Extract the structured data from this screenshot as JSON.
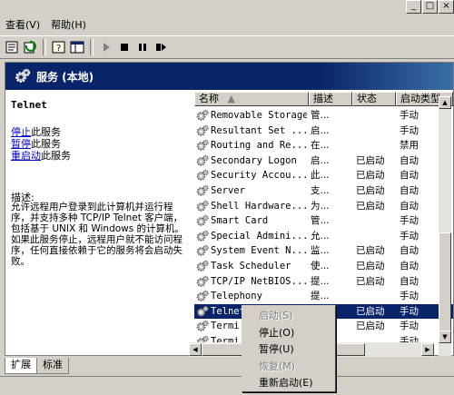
{
  "menu": {
    "items": [
      {
        "label": "查看(V)"
      },
      {
        "label": "帮助(H)"
      }
    ]
  },
  "window_controls": {
    "minimize": "_",
    "maximize": "□",
    "close": "×"
  },
  "header": {
    "title": "服务 (本地)"
  },
  "details": {
    "service_name": "Telnet",
    "actions": [
      {
        "link": "停止",
        "suffix": "此服务"
      },
      {
        "link": "暂停",
        "suffix": "此服务"
      },
      {
        "link": "重启动",
        "suffix": "此服务"
      }
    ],
    "description_label": "描述:",
    "description_text": "允许远程用户登录到此计算机并运行程序，并支持多种 TCP/IP Telnet 客户端，包括基于 UNIX 和 Windows 的计算机。如果此服务停止，远程用户就不能访问程序，任何直接依赖于它的服务将会启动失败。"
  },
  "list": {
    "columns": {
      "name": "名称",
      "description": "描述",
      "status": "状态",
      "startup": "启动类型"
    },
    "rows": [
      {
        "name": "Removable Storage",
        "description": "管...",
        "status": "",
        "startup": "手动"
      },
      {
        "name": "Resultant Set ...",
        "description": "启...",
        "status": "",
        "startup": "手动"
      },
      {
        "name": "Routing and Re...",
        "description": "在...",
        "status": "",
        "startup": "禁用"
      },
      {
        "name": "Secondary Logon",
        "description": "启...",
        "status": "已启动",
        "startup": "自动"
      },
      {
        "name": "Security Accou...",
        "description": "此...",
        "status": "已启动",
        "startup": "自动"
      },
      {
        "name": "Server",
        "description": "支...",
        "status": "已启动",
        "startup": "自动"
      },
      {
        "name": "Shell Hardware...",
        "description": "为...",
        "status": "已启动",
        "startup": "自动"
      },
      {
        "name": "Smart Card",
        "description": "管...",
        "status": "",
        "startup": "手动"
      },
      {
        "name": "Special Admini...",
        "description": "允...",
        "status": "",
        "startup": "手动"
      },
      {
        "name": "System Event N...",
        "description": "监...",
        "status": "已启动",
        "startup": "自动"
      },
      {
        "name": "Task Scheduler",
        "description": "使...",
        "status": "已启动",
        "startup": "自动"
      },
      {
        "name": "TCP/IP NetBIOS...",
        "description": "提...",
        "status": "已启动",
        "startup": "自动"
      },
      {
        "name": "Telephony",
        "description": "提...",
        "status": "",
        "startup": "手动"
      },
      {
        "name": "Telnet",
        "description": "",
        "status": "已启动",
        "startup": "手动"
      },
      {
        "name": "Termi",
        "description": "",
        "status": "已启动",
        "startup": "手动"
      },
      {
        "name": "Termi",
        "description": "",
        "status": "",
        "startup": "手动"
      }
    ],
    "selected_index": 13
  },
  "context_menu": {
    "items": [
      {
        "label": "启动(S)",
        "disabled": true
      },
      {
        "label": "停止(O)",
        "disabled": false
      },
      {
        "label": "暂停(U)",
        "disabled": false
      },
      {
        "label": "恢复(M)",
        "disabled": true
      },
      {
        "label": "重新启动(E)",
        "disabled": false
      }
    ]
  },
  "tabs": [
    {
      "label": "扩展",
      "active": true
    },
    {
      "label": "标准",
      "active": false
    }
  ],
  "colors": {
    "header_band": "#0a246a",
    "selection": "#0a246a",
    "link": "#0000cc",
    "chrome": "#d4d0c8"
  }
}
